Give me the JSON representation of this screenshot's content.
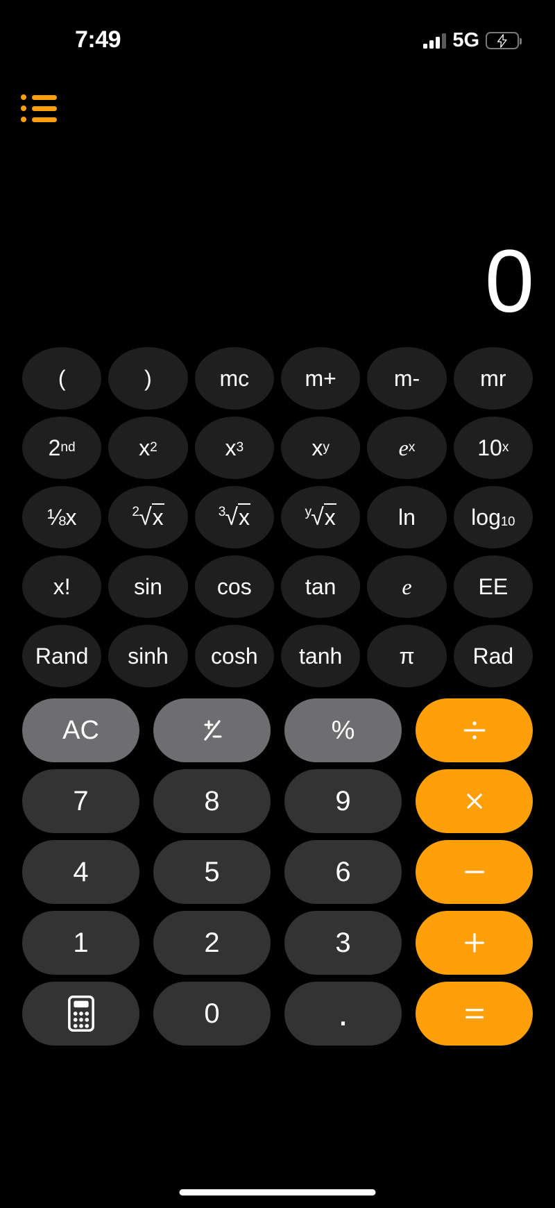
{
  "status_bar": {
    "time": "7:49",
    "network": "5G",
    "signal_icon": "signal-bars-icon",
    "battery_icon": "battery-charging-icon",
    "battery_color": "#30d158"
  },
  "menu": {
    "icon": "list-bullet-icon",
    "color": "#ff9f0a"
  },
  "display": {
    "value": "0"
  },
  "theme": {
    "background": "#000000",
    "sci_key_bg": "#1f1f1f",
    "digit_key_bg": "#333333",
    "func_key_bg": "#6e6e70",
    "operator_bg": "#ff9f0a",
    "text": "#ffffff"
  },
  "keypad": {
    "scientific_rows": [
      [
        {
          "label": "(",
          "name": "open-paren"
        },
        {
          "label": ")",
          "name": "close-paren"
        },
        {
          "label": "mc",
          "name": "memory-clear"
        },
        {
          "label": "m+",
          "name": "memory-add"
        },
        {
          "label": "m-",
          "name": "memory-subtract"
        },
        {
          "label": "mr",
          "name": "memory-recall"
        }
      ],
      [
        {
          "label": "2nd",
          "name": "second-function"
        },
        {
          "label": "x²",
          "name": "x-squared"
        },
        {
          "label": "x³",
          "name": "x-cubed"
        },
        {
          "label": "xʸ",
          "name": "x-to-the-y"
        },
        {
          "label": "eˣ",
          "name": "e-to-the-x"
        },
        {
          "label": "10ˣ",
          "name": "ten-to-the-x"
        }
      ],
      [
        {
          "label": "1/x",
          "name": "reciprocal"
        },
        {
          "label": "²√x",
          "name": "square-root"
        },
        {
          "label": "³√x",
          "name": "cube-root"
        },
        {
          "label": "ʸ√x",
          "name": "nth-root"
        },
        {
          "label": "ln",
          "name": "natural-log"
        },
        {
          "label": "log10",
          "name": "log-base-10"
        }
      ],
      [
        {
          "label": "x!",
          "name": "factorial"
        },
        {
          "label": "sin",
          "name": "sine"
        },
        {
          "label": "cos",
          "name": "cosine"
        },
        {
          "label": "tan",
          "name": "tangent"
        },
        {
          "label": "e",
          "name": "euler-number"
        },
        {
          "label": "EE",
          "name": "exponent-entry"
        }
      ],
      [
        {
          "label": "Rand",
          "name": "random"
        },
        {
          "label": "sinh",
          "name": "hyperbolic-sine"
        },
        {
          "label": "cosh",
          "name": "hyperbolic-cosine"
        },
        {
          "label": "tanh",
          "name": "hyperbolic-tangent"
        },
        {
          "label": "π",
          "name": "pi"
        },
        {
          "label": "Rad",
          "name": "radians-toggle"
        }
      ]
    ],
    "main_rows": [
      [
        {
          "label": "AC",
          "name": "all-clear",
          "style": "func"
        },
        {
          "label": "+/-",
          "name": "plus-minus",
          "style": "func"
        },
        {
          "label": "%",
          "name": "percent",
          "style": "func"
        },
        {
          "label": "÷",
          "name": "divide",
          "style": "op"
        }
      ],
      [
        {
          "label": "7",
          "name": "digit-7",
          "style": "digit"
        },
        {
          "label": "8",
          "name": "digit-8",
          "style": "digit"
        },
        {
          "label": "9",
          "name": "digit-9",
          "style": "digit"
        },
        {
          "label": "×",
          "name": "multiply",
          "style": "op"
        }
      ],
      [
        {
          "label": "4",
          "name": "digit-4",
          "style": "digit"
        },
        {
          "label": "5",
          "name": "digit-5",
          "style": "digit"
        },
        {
          "label": "6",
          "name": "digit-6",
          "style": "digit"
        },
        {
          "label": "−",
          "name": "subtract",
          "style": "op"
        }
      ],
      [
        {
          "label": "1",
          "name": "digit-1",
          "style": "digit"
        },
        {
          "label": "2",
          "name": "digit-2",
          "style": "digit"
        },
        {
          "label": "3",
          "name": "digit-3",
          "style": "digit"
        },
        {
          "label": "+",
          "name": "add",
          "style": "op"
        }
      ],
      [
        {
          "label": "",
          "name": "calculator-icon",
          "style": "digit"
        },
        {
          "label": "0",
          "name": "digit-0",
          "style": "digit"
        },
        {
          "label": ".",
          "name": "decimal-point",
          "style": "digit"
        },
        {
          "label": "=",
          "name": "equals",
          "style": "op"
        }
      ]
    ]
  },
  "home_indicator": "home-indicator"
}
